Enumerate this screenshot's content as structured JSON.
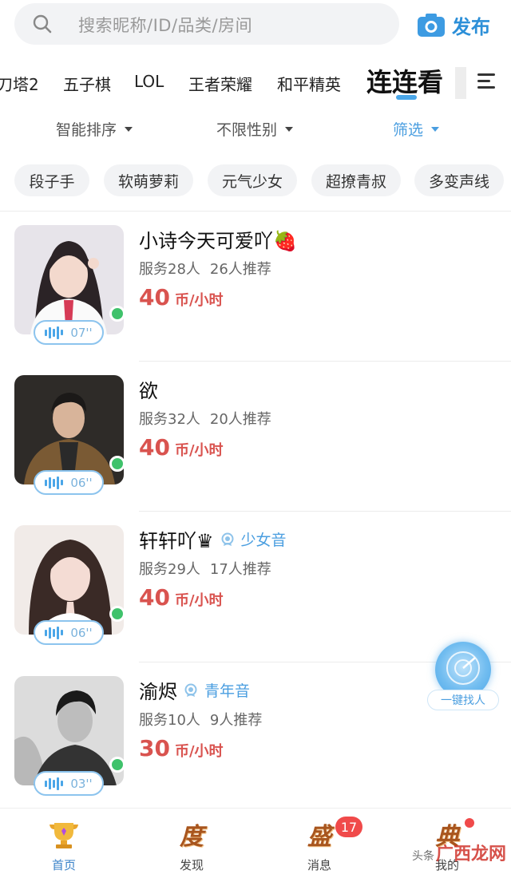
{
  "search": {
    "placeholder": "搜索昵称/ID/品类/房间"
  },
  "publish_label": "发布",
  "game_tabs": [
    "刀塔2",
    "五子棋",
    "LOL",
    "王者荣耀",
    "和平精英",
    "连连看"
  ],
  "active_tab": "连连看",
  "filters": {
    "sort": "智能排序",
    "gender": "不限性别",
    "screen": "筛选"
  },
  "voice_chips": [
    "段子手",
    "软萌萝莉",
    "元气少女",
    "超撩青叔",
    "多变声线"
  ],
  "players": [
    {
      "name": "小诗今天可爱吖🍓",
      "tag": "",
      "served": "服务28人",
      "recommend": "26人推荐",
      "price": "40",
      "unit": "币/小时",
      "voice": "07''"
    },
    {
      "name": "欲",
      "tag": "",
      "served": "服务32人",
      "recommend": "20人推荐",
      "price": "40",
      "unit": "币/小时",
      "voice": "06''"
    },
    {
      "name": "轩轩吖♛",
      "tag": "少女音",
      "served": "服务29人",
      "recommend": "17人推荐",
      "price": "40",
      "unit": "币/小时",
      "voice": "06''"
    },
    {
      "name": "渝烬",
      "tag": "青年音",
      "served": "服务10人",
      "recommend": "9人推荐",
      "price": "30",
      "unit": "币/小时",
      "voice": "03''"
    }
  ],
  "finder_label": "一键找人",
  "bottom_nav": [
    {
      "label": "首页",
      "icon": "trophy-icon",
      "glyph": ""
    },
    {
      "label": "发现",
      "icon": "discover-icon",
      "glyph": "度"
    },
    {
      "label": "消息",
      "icon": "message-icon",
      "glyph": "盛"
    },
    {
      "label": "我的",
      "icon": "profile-icon",
      "glyph": "典"
    }
  ],
  "message_badge": "17",
  "watermark": {
    "prefix": "头条",
    "brand": "广西龙网"
  },
  "colors": {
    "accent": "#4a9ee0",
    "price": "#d9534f",
    "online": "#3fc26b",
    "badge": "#f04a4a"
  }
}
